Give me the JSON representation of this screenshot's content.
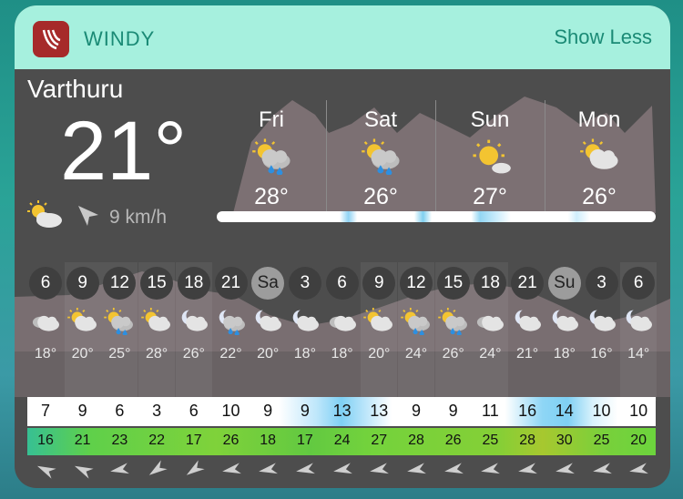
{
  "widget": {
    "app_name": "WINDY",
    "show_less": "Show Less"
  },
  "current": {
    "location": "Varthuru",
    "temperature": "21°",
    "wind": "9 km/h",
    "icon": "partly-cloudy-icon",
    "wind_direction_icon": "wind-arrow-icon"
  },
  "days": [
    {
      "name": "Fri",
      "temp": "28°",
      "icon": "sun-cloud-rain-icon"
    },
    {
      "name": "Sat",
      "temp": "26°",
      "icon": "sun-cloud-rain-icon"
    },
    {
      "name": "Sun",
      "temp": "27°",
      "icon": "sunny-icon"
    },
    {
      "name": "Mon",
      "temp": "26°",
      "icon": "partly-cloudy-icon"
    }
  ],
  "hourly": {
    "hours": [
      "6",
      "9",
      "12",
      "15",
      "18",
      "21",
      "Sa",
      "3",
      "6",
      "9",
      "12",
      "15",
      "18",
      "21",
      "Su",
      "3",
      "6"
    ],
    "temps": [
      "18°",
      "20°",
      "25°",
      "28°",
      "26°",
      "22°",
      "20°",
      "18°",
      "18°",
      "20°",
      "24°",
      "26°",
      "24°",
      "21°",
      "18°",
      "16°",
      "14°"
    ],
    "icons": [
      "cloudy-icon",
      "partly-cloudy-icon",
      "sun-cloud-rain-icon",
      "partly-cloudy-icon",
      "moon-cloud-icon",
      "moon-cloud-rain-icon",
      "moon-cloud-icon",
      "moon-cloud-icon",
      "cloudy-icon",
      "partly-cloudy-icon",
      "sun-cloud-rain-icon",
      "sun-cloud-rain-icon",
      "cloudy-icon",
      "moon-cloud-icon",
      "moon-cloud-icon",
      "moon-cloud-icon",
      "moon-cloud-icon"
    ],
    "wind": [
      "7",
      "9",
      "6",
      "3",
      "6",
      "10",
      "9",
      "9",
      "13",
      "13",
      "9",
      "9",
      "11",
      "16",
      "14",
      "10",
      "10"
    ],
    "gusts": [
      "16",
      "21",
      "23",
      "22",
      "17",
      "26",
      "18",
      "17",
      "24",
      "27",
      "28",
      "26",
      "25",
      "28",
      "30",
      "25",
      "20"
    ]
  },
  "colors": {
    "header_bg": "#a6f0de",
    "accent": "#1a8a75",
    "card_bg": "#4d4d4d",
    "app_icon_bg": "#a62a2a"
  }
}
